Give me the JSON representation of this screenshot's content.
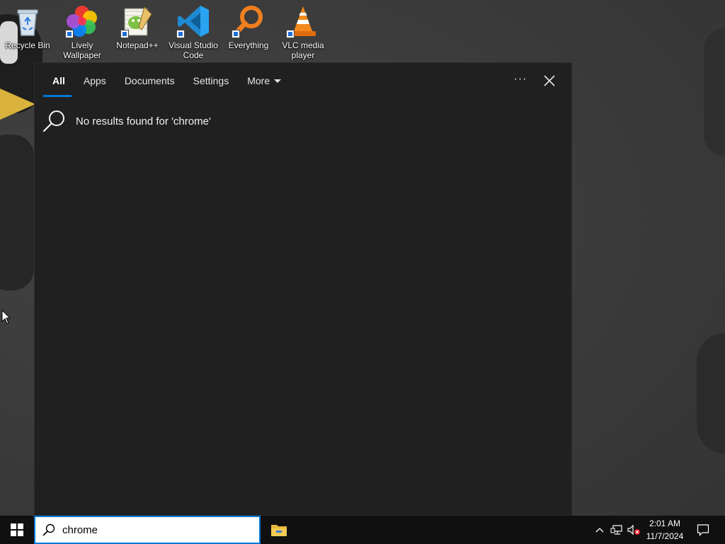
{
  "desktop": {
    "icons": [
      {
        "label": "Recycle Bin",
        "icon": "recycle-bin-icon"
      },
      {
        "label": "Lively Wallpaper",
        "icon": "lively-wallpaper-icon"
      },
      {
        "label": "Notepad++",
        "icon": "notepad-plus-plus-icon"
      },
      {
        "label": "Visual Studio Code",
        "icon": "vscode-icon"
      },
      {
        "label": "Everything",
        "icon": "everything-search-icon"
      },
      {
        "label": "VLC media player",
        "icon": "vlc-icon"
      }
    ]
  },
  "search_panel": {
    "tabs": [
      {
        "label": "All",
        "active": true
      },
      {
        "label": "Apps",
        "active": false
      },
      {
        "label": "Documents",
        "active": false
      },
      {
        "label": "Settings",
        "active": false
      },
      {
        "label": "More",
        "active": false,
        "dropdown": true
      }
    ],
    "options_label": "···",
    "no_results_text": "No results found for 'chrome'",
    "accent_color": "#0078d7"
  },
  "taskbar": {
    "search": {
      "value": "chrome"
    },
    "pinned_apps": [
      {
        "name": "File Explorer",
        "icon": "file-explorer-icon"
      }
    ],
    "tray_icons": [
      "chevron-up-icon",
      "network-icon",
      "volume-muted-icon"
    ],
    "clock": {
      "time": "2:01 AM",
      "date": "11/7/2024"
    },
    "notification_icon": "action-center-icon"
  }
}
